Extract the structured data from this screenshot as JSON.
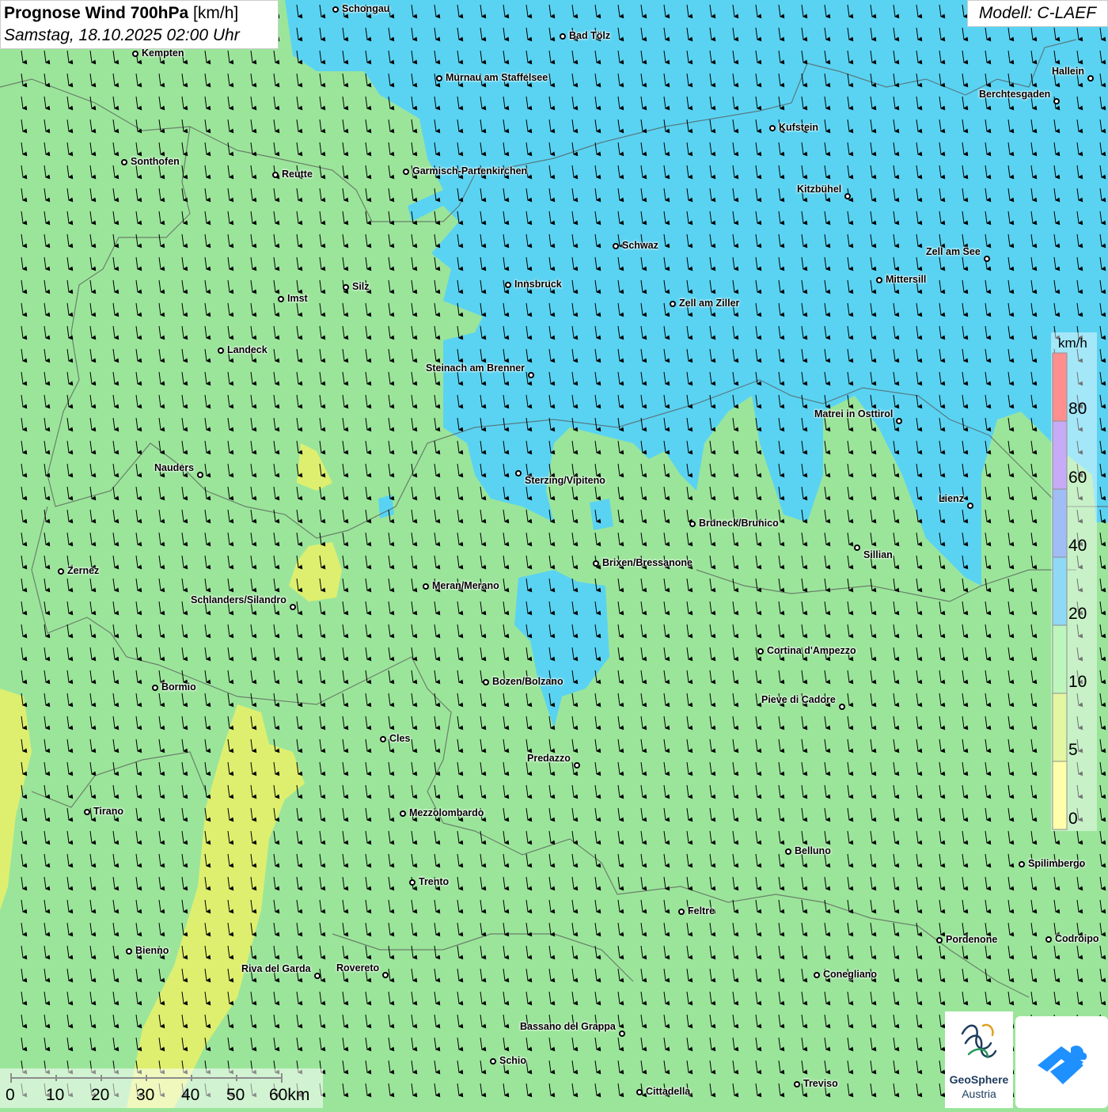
{
  "header": {
    "title_bold": "Prognose Wind 700hPa",
    "title_unit": "[km/h]",
    "datetime": "Samstag, 18.10.2025 02:00 Uhr"
  },
  "model": {
    "label": "Modell: C-LAEF"
  },
  "cities": [
    {
      "name": "Schongau"
    },
    {
      "name": "Bad Tölz"
    },
    {
      "name": "Kempten"
    },
    {
      "name": "Murnau am Staffelsee"
    },
    {
      "name": "Hallein"
    },
    {
      "name": "Berchtesgaden"
    },
    {
      "name": "Kufstein"
    },
    {
      "name": "Sonthofen"
    },
    {
      "name": "Reutte"
    },
    {
      "name": "Garmisch-Partenkirchen"
    },
    {
      "name": "Kitzbühel"
    },
    {
      "name": "Schwaz"
    },
    {
      "name": "Zell am See"
    },
    {
      "name": "Innsbruck"
    },
    {
      "name": "Mittersill"
    },
    {
      "name": "Silz"
    },
    {
      "name": "Imst"
    },
    {
      "name": "Zell am Ziller"
    },
    {
      "name": "Landeck"
    },
    {
      "name": "Steinach am Brenner"
    },
    {
      "name": "Matrei in Osttirol"
    },
    {
      "name": "Nauders"
    },
    {
      "name": "Sterzing/Vipiteno"
    },
    {
      "name": "Lienz"
    },
    {
      "name": "Bruneck/Brunico"
    },
    {
      "name": "Sillian"
    },
    {
      "name": "Zernez"
    },
    {
      "name": "Brixen/Bressanone"
    },
    {
      "name": "Meran/Merano"
    },
    {
      "name": "Schlanders/Silandro"
    },
    {
      "name": "Cortina d'Ampezzo"
    },
    {
      "name": "Bozen/Bolzano"
    },
    {
      "name": "Bormio"
    },
    {
      "name": "Pieve di Cadore"
    },
    {
      "name": "Cles"
    },
    {
      "name": "Predazzo"
    },
    {
      "name": "Tirano"
    },
    {
      "name": "Mezzolombardo"
    },
    {
      "name": "Belluno"
    },
    {
      "name": "Spilimbergo"
    },
    {
      "name": "Trento"
    },
    {
      "name": "Feltre"
    },
    {
      "name": "Pordenone"
    },
    {
      "name": "Codroipo"
    },
    {
      "name": "Bienno"
    },
    {
      "name": "Riva del Garda"
    },
    {
      "name": "Rovereto"
    },
    {
      "name": "Conegliano"
    },
    {
      "name": "Bassano del Grappa"
    },
    {
      "name": "Schio"
    },
    {
      "name": "Treviso"
    },
    {
      "name": "Cittadella"
    }
  ],
  "legend": {
    "unit": "km/h",
    "labels": [
      "80",
      "60",
      "40",
      "20",
      "10",
      "5",
      "0"
    ],
    "colors": [
      "#ff3333",
      "#9966ee",
      "#5588ee",
      "#33bbee",
      "#88ee88",
      "#ccee55",
      "#ffff66"
    ]
  },
  "colors": {
    "calm_yellow": "#e6f06a",
    "light_green": "#9be59b",
    "blue": "#5ad3f2"
  },
  "scale_bar": {
    "labels": [
      "0",
      "10",
      "20",
      "30",
      "40",
      "50",
      "60km"
    ]
  },
  "logos": {
    "geosphere_line1": "GeoSphere",
    "geosphere_line2": "Austria"
  }
}
